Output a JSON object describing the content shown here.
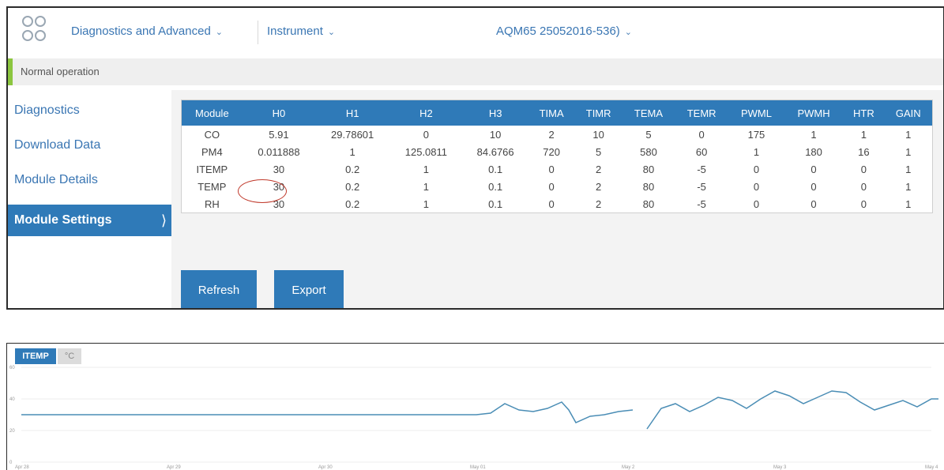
{
  "header": {
    "nav1": "Diagnostics and Advanced",
    "nav2": "Instrument",
    "instrument_selector": "AQM65 25052016-536)"
  },
  "status": "Normal operation",
  "sidebar": {
    "items": [
      {
        "label": "Diagnostics"
      },
      {
        "label": "Download Data"
      },
      {
        "label": "Module Details"
      },
      {
        "label": "Module Settings",
        "active": true
      }
    ]
  },
  "table": {
    "columns": [
      "Module",
      "H0",
      "H1",
      "H2",
      "H3",
      "TIMA",
      "TIMR",
      "TEMA",
      "TEMR",
      "PWML",
      "PWMH",
      "HTR",
      "GAIN"
    ],
    "rows": [
      [
        "CO",
        "5.91",
        "29.78601",
        "0",
        "10",
        "2",
        "10",
        "5",
        "0",
        "175",
        "1",
        "1",
        "1"
      ],
      [
        "PM4",
        "0.011888",
        "1",
        "125.0811",
        "84.6766",
        "720",
        "5",
        "580",
        "60",
        "1",
        "180",
        "16",
        "1"
      ],
      [
        "ITEMP",
        "30",
        "0.2",
        "1",
        "0.1",
        "0",
        "2",
        "80",
        "-5",
        "0",
        "0",
        "0",
        "1"
      ],
      [
        "TEMP",
        "30",
        "0.2",
        "1",
        "0.1",
        "0",
        "2",
        "80",
        "-5",
        "0",
        "0",
        "0",
        "1"
      ],
      [
        "RH",
        "30",
        "0.2",
        "1",
        "0.1",
        "0",
        "2",
        "80",
        "-5",
        "0",
        "0",
        "0",
        "1"
      ]
    ]
  },
  "buttons": {
    "refresh": "Refresh",
    "export": "Export"
  },
  "chart": {
    "tab": "ITEMP",
    "unit": "°C"
  },
  "chart_data": {
    "type": "line",
    "title": "ITEMP",
    "ylabel": "°C",
    "ylim": [
      0,
      60
    ],
    "yticks": [
      0,
      20,
      40,
      60
    ],
    "xticks": [
      "Apr 28",
      "Apr 29",
      "Apr 30",
      "May 01",
      "May 2",
      "May 3",
      "May 4"
    ],
    "x_range_days": [
      0,
      6.4
    ],
    "series": [
      {
        "segments": [
          [
            [
              0,
              30
            ],
            [
              3.2,
              30
            ],
            [
              3.3,
              31
            ],
            [
              3.4,
              37
            ],
            [
              3.5,
              33
            ],
            [
              3.6,
              32
            ],
            [
              3.7,
              34
            ],
            [
              3.8,
              38
            ],
            [
              3.85,
              33
            ],
            [
              3.9,
              25
            ],
            [
              4.0,
              29
            ],
            [
              4.1,
              30
            ],
            [
              4.2,
              32
            ],
            [
              4.3,
              33
            ]
          ],
          [
            [
              4.4,
              21
            ],
            [
              4.5,
              34
            ],
            [
              4.6,
              37
            ],
            [
              4.7,
              32
            ],
            [
              4.8,
              36
            ],
            [
              4.9,
              41
            ],
            [
              5.0,
              39
            ],
            [
              5.1,
              34
            ],
            [
              5.2,
              40
            ],
            [
              5.3,
              45
            ],
            [
              5.4,
              42
            ],
            [
              5.5,
              37
            ],
            [
              5.6,
              41
            ],
            [
              5.7,
              45
            ],
            [
              5.8,
              44
            ],
            [
              5.9,
              38
            ],
            [
              6.0,
              33
            ],
            [
              6.1,
              36
            ],
            [
              6.2,
              39
            ],
            [
              6.3,
              35
            ],
            [
              6.4,
              40
            ],
            [
              6.45,
              40
            ]
          ]
        ]
      }
    ]
  },
  "colors": {
    "accent": "#2f7ab8",
    "status_ok": "#8cc63f",
    "line": "#4a8db5",
    "highlight": "#c0392b"
  }
}
